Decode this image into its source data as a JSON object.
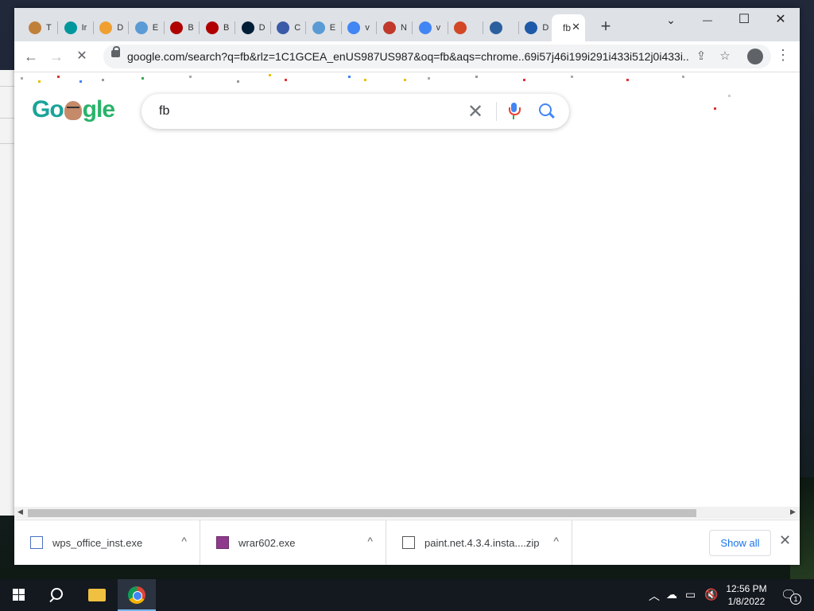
{
  "browser": {
    "tabs": [
      {
        "title": "T",
        "color": "#c0803a"
      },
      {
        "title": "Ir",
        "color": "#00979d"
      },
      {
        "title": "D",
        "color": "#f0a030"
      },
      {
        "title": "E",
        "color": "#5b9bd5"
      },
      {
        "title": "B",
        "color": "#b00000"
      },
      {
        "title": "B",
        "color": "#b00000"
      },
      {
        "title": "D",
        "color": "#001e36"
      },
      {
        "title": "C",
        "color": "#3b5aa8"
      },
      {
        "title": "E",
        "color": "#5b9bd5"
      },
      {
        "title": "v",
        "color": "#4285f4"
      },
      {
        "title": "N",
        "color": "#c0392b"
      },
      {
        "title": "v",
        "color": "#4285f4"
      },
      {
        "title": "",
        "color": "#d24726"
      },
      {
        "title": "",
        "color": "#2c5f9e"
      },
      {
        "title": "D",
        "color": "#1e5aa8"
      }
    ],
    "active_tab": {
      "title": "fb",
      "close": "✕"
    },
    "new_tab_label": "+",
    "window_controls": {
      "dropdown": "⌄",
      "minimize": "—",
      "maximize": "☐",
      "close": "✕"
    },
    "nav": {
      "back": "←",
      "forward": "→",
      "reload": "✕"
    },
    "url": "google.com/search?q=fb&rlz=1C1GCEA_enUS987US987&oq=fb&aqs=chrome..69i57j46i199i291i433i512j0i433i...",
    "share_icon": "⇪",
    "star_icon": "☆",
    "menu_icon": "⋮"
  },
  "page": {
    "logo_text": {
      "g1": "Go",
      "g2": "gle"
    },
    "search_query": "fb",
    "clear_icon": "✕"
  },
  "downloads": {
    "items": [
      {
        "name": "wps_office_inst.exe",
        "icon_color": "#4a6fc4"
      },
      {
        "name": "wrar602.exe",
        "icon_color": "#8e3b8e"
      },
      {
        "name": "paint.net.4.3.4.insta....zip",
        "icon_color": "#555555"
      }
    ],
    "chevron": "^",
    "show_all": "Show all",
    "close": "✕"
  },
  "taskbar": {
    "time": "12:56 PM",
    "date": "1/8/2022",
    "notification_count": "1"
  },
  "colors": {
    "google_blue": "#4285f4",
    "accent_blue": "#1a73e8"
  }
}
